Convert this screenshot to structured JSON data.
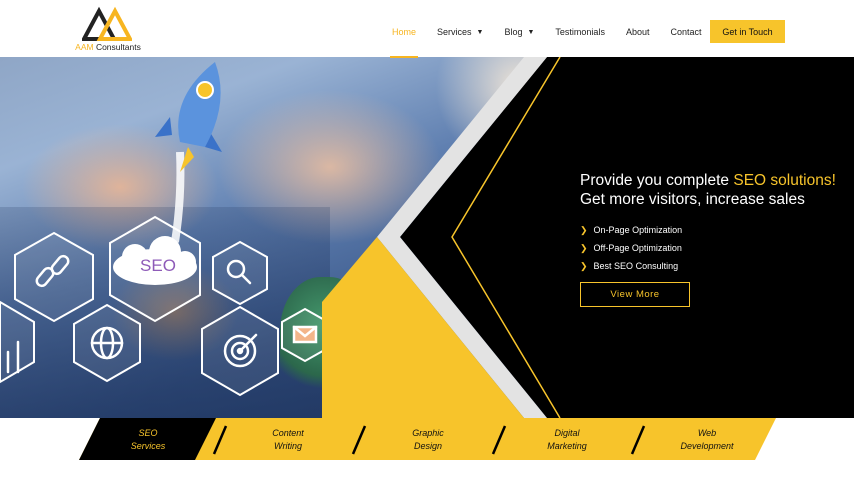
{
  "brand": {
    "name_part1": "AAM",
    "name_part2": " Consultants"
  },
  "nav": {
    "items": [
      {
        "label": "Home",
        "active": true,
        "dropdown": false
      },
      {
        "label": "Services",
        "active": false,
        "dropdown": true
      },
      {
        "label": "Blog",
        "active": false,
        "dropdown": true
      },
      {
        "label": "Testimonials",
        "active": false,
        "dropdown": false
      },
      {
        "label": "About",
        "active": false,
        "dropdown": false
      },
      {
        "label": "Contact",
        "active": false,
        "dropdown": false
      }
    ],
    "cta_label": "Get in Touch"
  },
  "hero": {
    "headline_line1_prefix": "Provide you complete ",
    "headline_line1_highlight": "SEO solutions!",
    "headline_line2": "Get more visitors, increase sales",
    "bullets": [
      "On-Page Optimization",
      "Off-Page Optimization",
      "Best SEO Consulting"
    ],
    "button_label": "View More",
    "image_badge": "SEO"
  },
  "categories": [
    {
      "line1": "SEO",
      "line2": "Services",
      "active": true
    },
    {
      "line1": "Content",
      "line2": "Writing",
      "active": false
    },
    {
      "line1": "Graphic",
      "line2": "Design",
      "active": false
    },
    {
      "line1": "Digital",
      "line2": "Marketing",
      "active": false
    },
    {
      "line1": "Web",
      "line2": "Development",
      "active": false
    }
  ],
  "colors": {
    "accent": "#f7c42b",
    "dark": "#000000",
    "grey": "#e3e3e3"
  }
}
